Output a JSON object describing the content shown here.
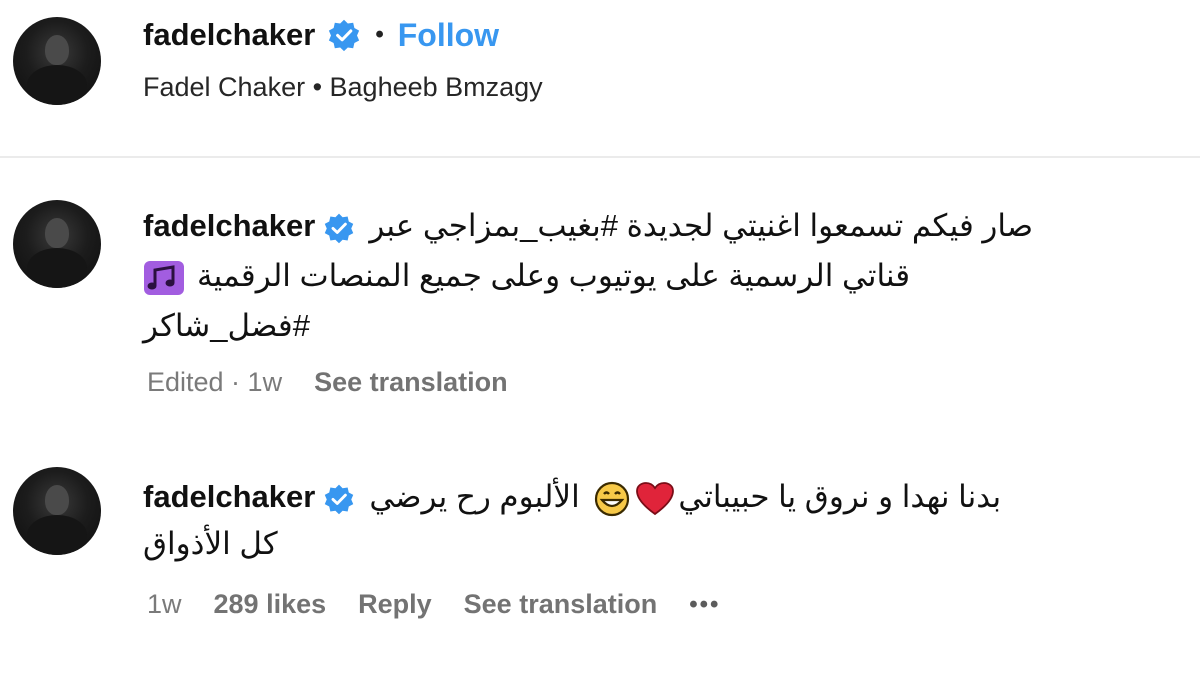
{
  "post": {
    "username": "fadelchaker",
    "separator": "•",
    "follow_label": "Follow",
    "subtitle": "Fadel Chaker • Bagheeb Bmzagy"
  },
  "comments": [
    {
      "username": "fadelchaker",
      "line1": "صار فيكم تسمعوا اغنيتي لجديدة #بغيب_بمزاجي عبر",
      "line2": "قناتي الرسمية على يوتيوب وعلى جميع المنصات الرقمية",
      "line2_icon": "music-notes-icon",
      "line3": "#فضل_شاكر",
      "edited": "Edited · 1w",
      "see_translation": "See translation"
    },
    {
      "username": "fadelchaker",
      "line1_part1": "بدنا نهدا و نروق يا حبيباتي",
      "line1_part2": "الألبوم رح يرضي",
      "line1_icons": [
        "heart-icon",
        "grinning-face-icon"
      ],
      "line2": "كل الأذواق",
      "time": "1w",
      "likes": "289 likes",
      "reply": "Reply",
      "see_translation": "See translation",
      "more": "•••"
    }
  ],
  "colors": {
    "follow": "#3897f0",
    "verified": "#3897f0",
    "muted": "#7a7a7a",
    "heart": "#e0243a"
  }
}
